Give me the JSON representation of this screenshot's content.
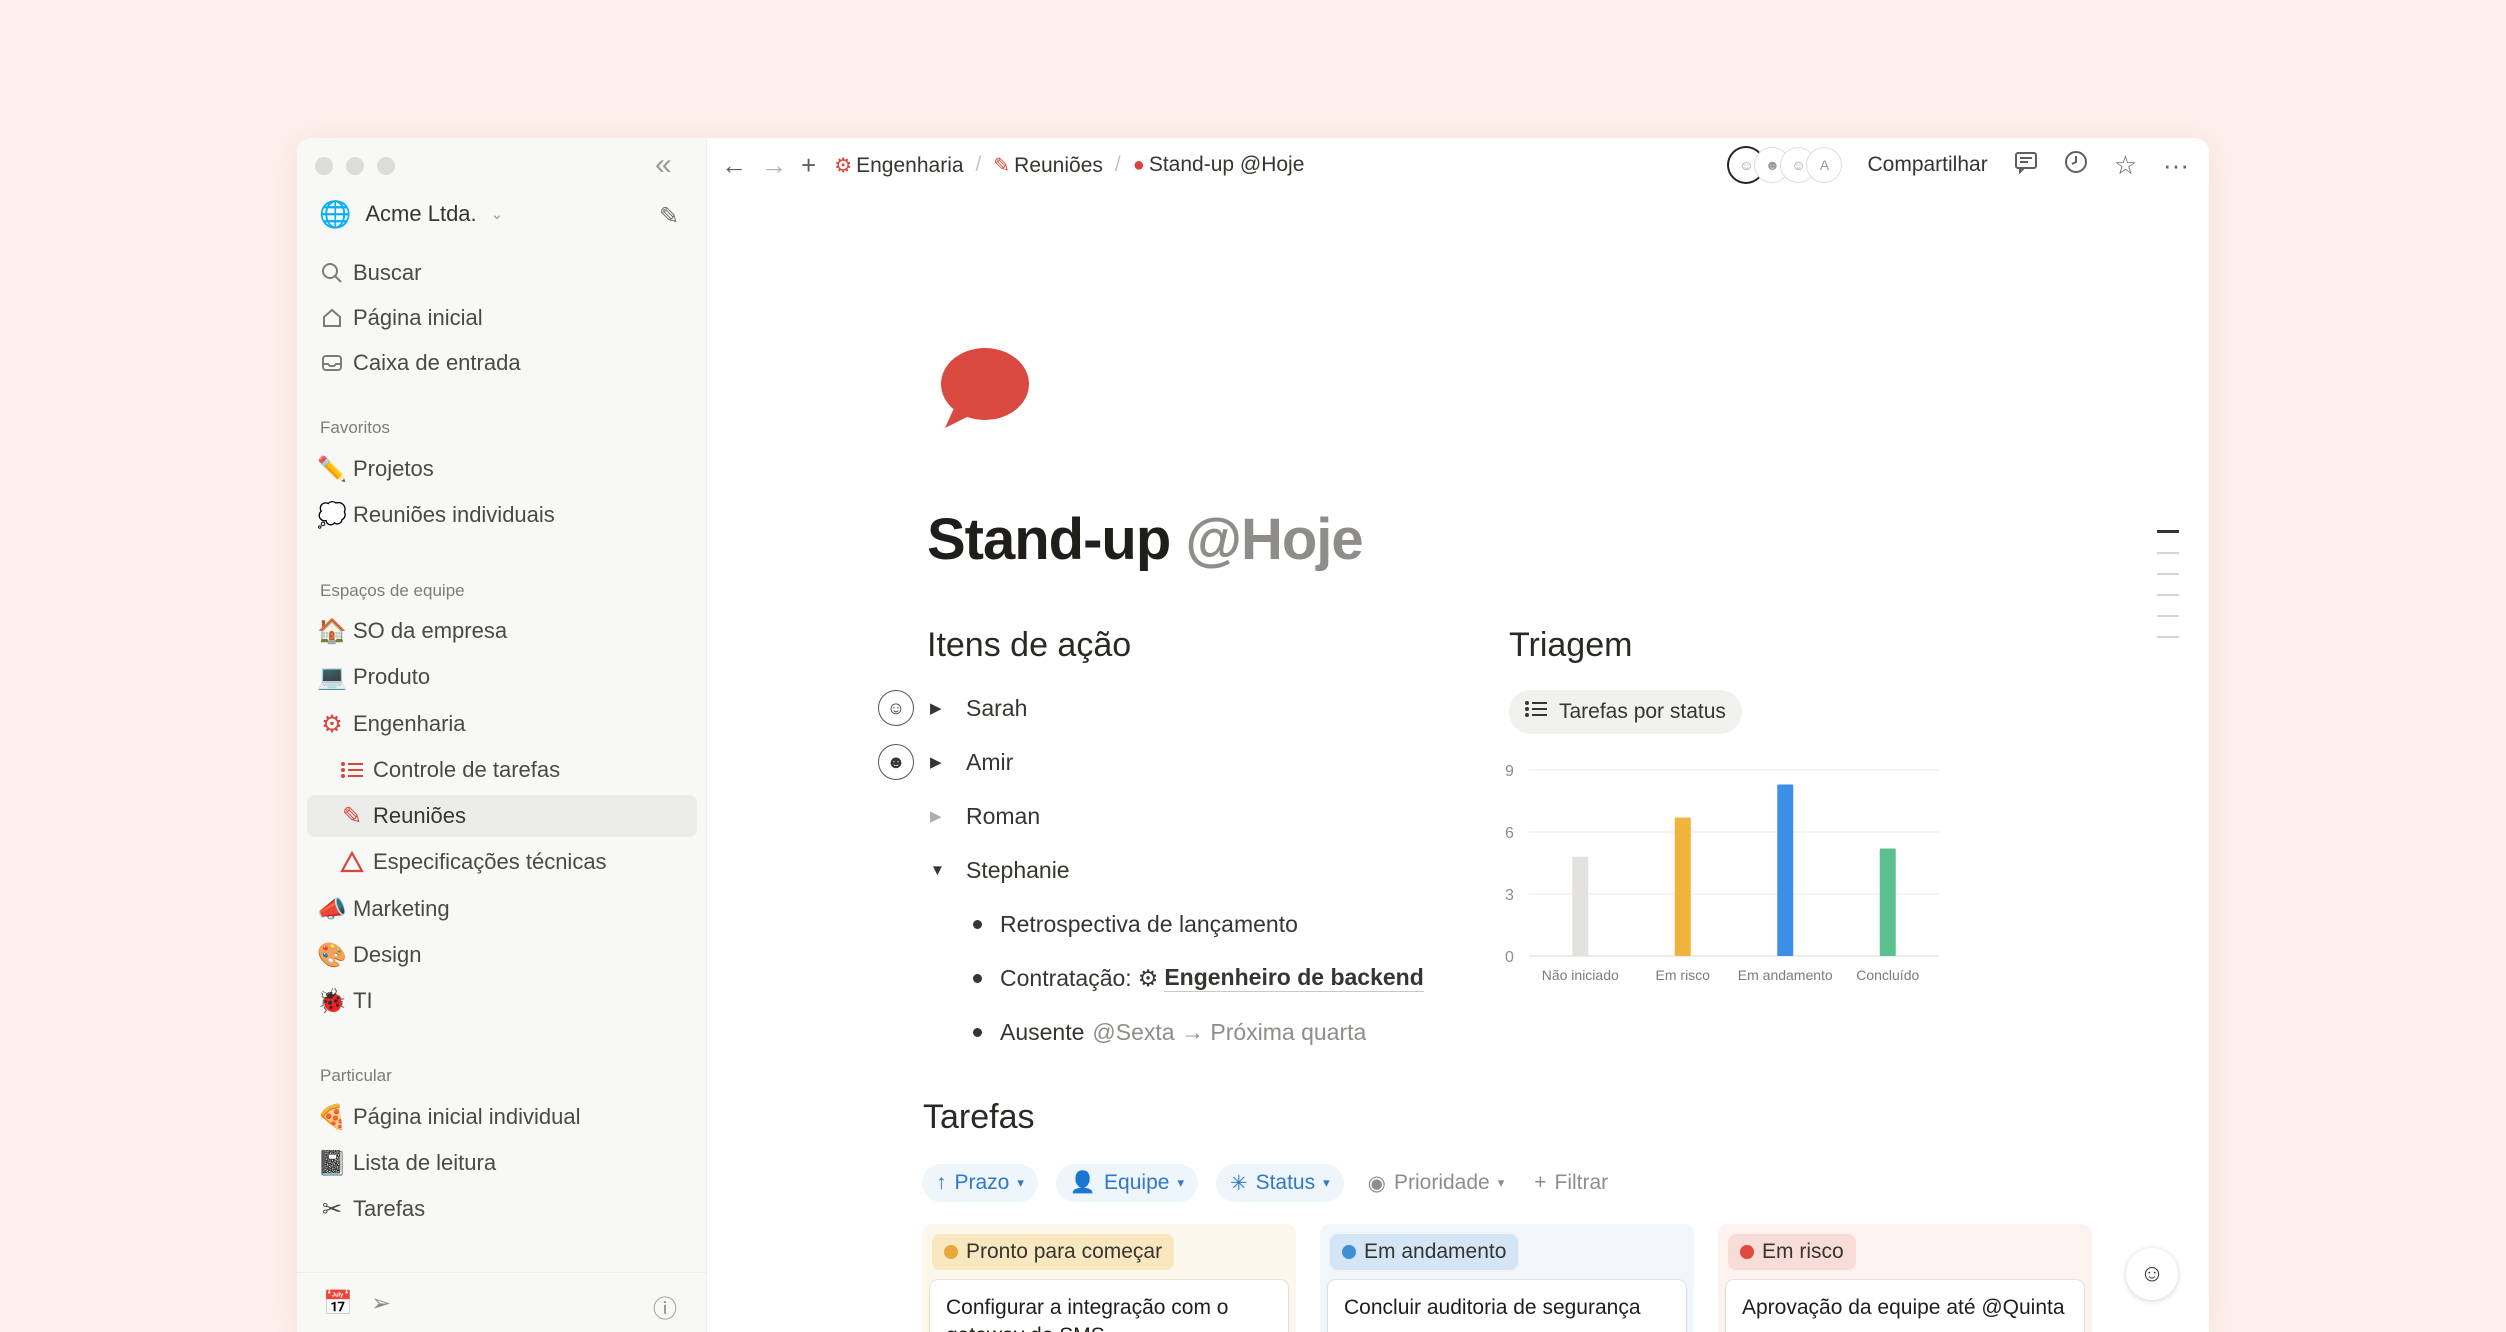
{
  "sidebar": {
    "workspace": "Acme Ltda.",
    "nav": [
      {
        "icon": "search-icon",
        "label": "Buscar"
      },
      {
        "icon": "home-icon",
        "label": "Página inicial"
      },
      {
        "icon": "inbox-icon",
        "label": "Caixa de entrada"
      }
    ],
    "favorites_label": "Favoritos",
    "favorites": [
      {
        "icon": "pencil-icon",
        "label": "Projetos"
      },
      {
        "icon": "speech-bubble-icon",
        "label": "Reuniões individuais"
      }
    ],
    "team_label": "Espaços de equipe",
    "team": [
      {
        "icon": "house-icon",
        "label": "SO da empresa"
      },
      {
        "icon": "laptop-icon",
        "label": "Produto"
      },
      {
        "icon": "gear-icon",
        "label": "Engenharia"
      },
      {
        "icon": "list-icon",
        "label": "Controle de tarefas"
      },
      {
        "icon": "pencil-icon",
        "label": "Reuniões"
      },
      {
        "icon": "triangle-icon",
        "label": "Especificações técnicas"
      },
      {
        "icon": "megaphone-icon",
        "label": "Marketing"
      },
      {
        "icon": "palette-icon",
        "label": "Design"
      },
      {
        "icon": "bug-icon",
        "label": "TI"
      }
    ],
    "private_label": "Particular",
    "private": [
      {
        "icon": "pizza-icon",
        "label": "Página inicial individual"
      },
      {
        "icon": "book-icon",
        "label": "Lista de leitura"
      },
      {
        "icon": "scissors-icon",
        "label": "Tarefas"
      }
    ]
  },
  "topbar": {
    "breadcrumbs": [
      "Engenharia",
      "Reuniões",
      "Stand-up @Hoje"
    ],
    "avatar_letter": "A",
    "share_label": "Compartilhar"
  },
  "page": {
    "title": "Stand-up",
    "title_mention": "@Hoje",
    "action_heading": "Itens de ação",
    "people": [
      "Sarah",
      "Amir",
      "Roman",
      "Stephanie"
    ],
    "bullets": {
      "b1": "Retrospectiva de lançamento",
      "b2_prefix": "Contratação:",
      "b2_link": "Engenheiro de backend",
      "b3_prefix": "Ausente",
      "b3_mention": "@Sexta → Próxima quarta"
    },
    "triage_heading": "Triagem",
    "triage_view": "Tarefas por status",
    "tasks_heading": "Tarefas",
    "filters": [
      "Prazo",
      "Equipe",
      "Status"
    ],
    "filters_plain": [
      "Prioridade",
      "Filtrar"
    ],
    "board": [
      {
        "status": "Pronto para começar",
        "color": "#e8a93a",
        "card": "Configurar a integração com o gateway de SMS"
      },
      {
        "status": "Em andamento",
        "color": "#3d8fd6",
        "card": "Concluir auditoria de segurança"
      },
      {
        "status": "Em risco",
        "color": "#e0493f",
        "card": "Aprovação da equipe até @Quinta"
      }
    ]
  },
  "chart_data": {
    "type": "bar",
    "categories": [
      "Não iniciado",
      "Em risco",
      "Em andamento",
      "Concluído"
    ],
    "values": [
      4.8,
      6.7,
      8.3,
      5.2
    ],
    "colors": [
      "#e3e2e0",
      "#f0b43c",
      "#3b8fe6",
      "#5cc08e"
    ],
    "yticks": [
      0,
      3,
      6,
      9
    ],
    "ylim": [
      0,
      9
    ],
    "grid": true
  }
}
